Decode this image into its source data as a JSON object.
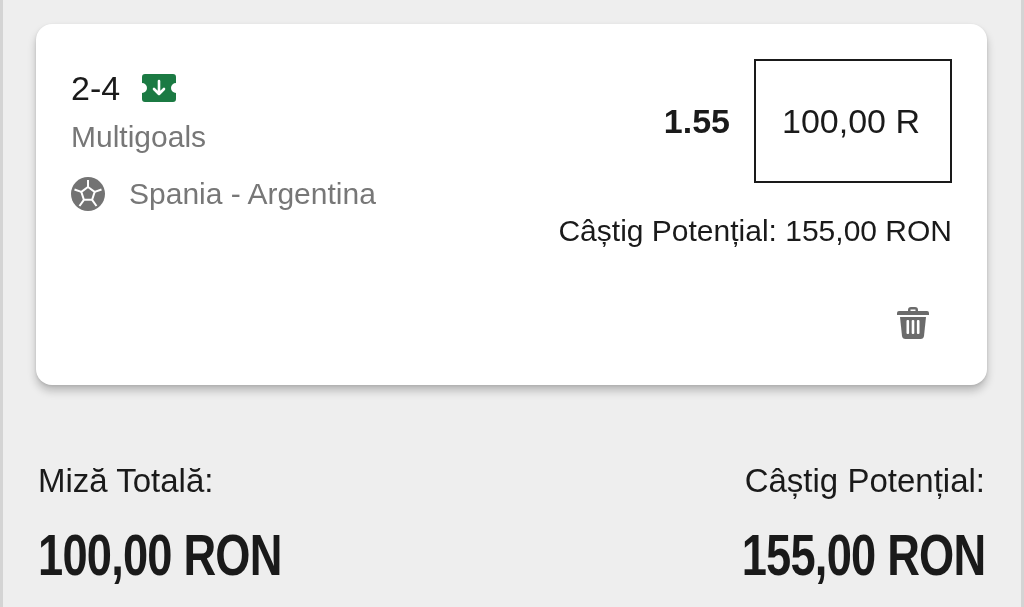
{
  "bet": {
    "selection": "2-4",
    "market": "Multigoals",
    "event": "Spania - Argentina",
    "odds": "1.55",
    "stake": {
      "value": "100,00 R"
    },
    "potential_win": "Câștig Potențial: 155,00 RON"
  },
  "summary": {
    "total_stake_label": "Miză Totală:",
    "total_stake": "100,00 RON",
    "potential_win_label": "Câștig Potențial:",
    "potential_win": "155,00 RON"
  }
}
